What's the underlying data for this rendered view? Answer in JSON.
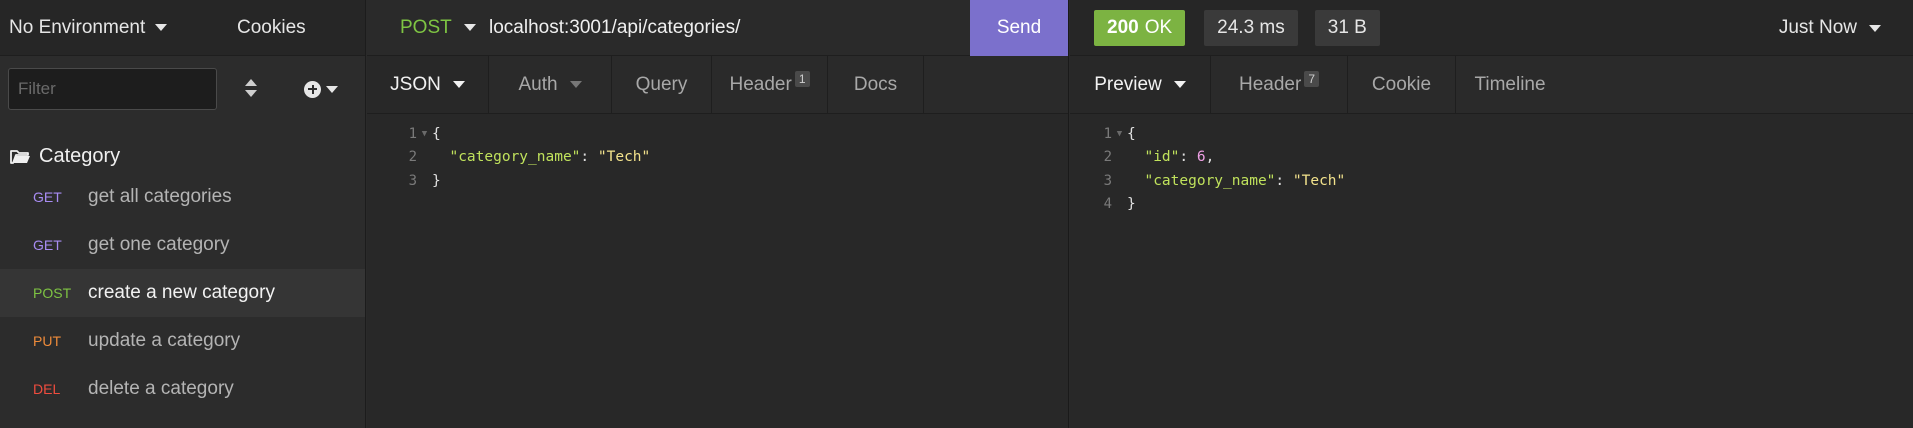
{
  "sidebar": {
    "environment": "No Environment",
    "cookies": "Cookies",
    "filter_placeholder": "Filter",
    "folder": "Category",
    "requests": [
      {
        "method": "GET",
        "name": "get all categories"
      },
      {
        "method": "GET",
        "name": "get one category"
      },
      {
        "method": "POST",
        "name": "create a new category"
      },
      {
        "method": "PUT",
        "name": "update a category"
      },
      {
        "method": "DEL",
        "name": "delete a category"
      }
    ],
    "active_request_index": 2
  },
  "request": {
    "method": "POST",
    "url": "localhost:3001/api/categories/",
    "send_label": "Send",
    "tabs": {
      "body": "JSON",
      "auth": "Auth",
      "query": "Query",
      "header": "Header",
      "header_count": "1",
      "docs": "Docs"
    },
    "body_lines": [
      {
        "num": "1",
        "text": "{"
      },
      {
        "num": "2",
        "key": "\"category_name\"",
        "value": "\"Tech\""
      },
      {
        "num": "3",
        "text": "}"
      }
    ]
  },
  "response": {
    "status_code": "200",
    "status_text": "OK",
    "time": "24.3 ms",
    "size": "31 B",
    "history": "Just Now",
    "tabs": {
      "preview": "Preview",
      "header": "Header",
      "header_count": "7",
      "cookie": "Cookie",
      "timeline": "Timeline"
    },
    "body_lines": [
      {
        "num": "1",
        "text": "{"
      },
      {
        "num": "2",
        "key": "\"id\"",
        "value": "6"
      },
      {
        "num": "3",
        "key": "\"category_name\"",
        "value": "\"Tech\""
      },
      {
        "num": "4",
        "text": "}"
      }
    ]
  },
  "colors": {
    "send": "#7b70cc",
    "status_ok": "#7cb342",
    "get": "#a88cf3",
    "post": "#7ec443",
    "put": "#ee8b3a",
    "delete": "#ef4c3e"
  },
  "icons": [
    "caret-down-icon",
    "sort-icon",
    "add-circle-icon",
    "folder-open-icon",
    "fold-arrow-icon"
  ]
}
